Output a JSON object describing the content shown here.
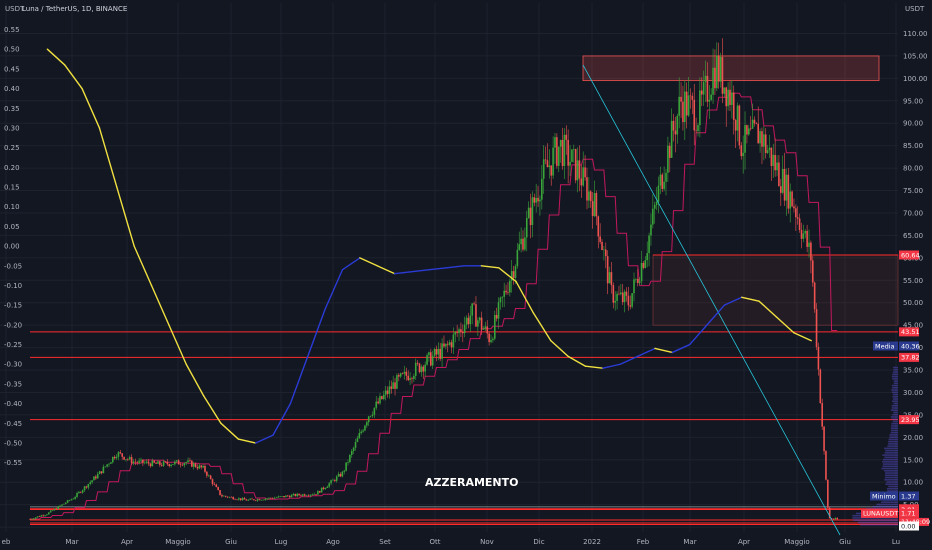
{
  "chart_data": {
    "type": "candlestick",
    "title": "Luna / TetherUS, 1D, BINANCE",
    "left_axis": {
      "unit": "USDT",
      "range": [
        -0.575,
        0.575
      ],
      "ticks": [
        "0.55",
        "0.50",
        "0.45",
        "0.40",
        "0.35",
        "0.30",
        "0.25",
        "0.20",
        "0.15",
        "0.10",
        "0.05",
        "0.00",
        "-0.05",
        "-0.10",
        "-0.15",
        "-0.20",
        "-0.25",
        "-0.30",
        "-0.35",
        "-0.40",
        "-0.45",
        "-0.50",
        "-0.55"
      ]
    },
    "right_axis": {
      "unit": "USDT",
      "ticks": [
        "110.00",
        "105.00",
        "100.00",
        "95.00",
        "90.00",
        "85.00",
        "80.00",
        "75.00",
        "70.00",
        "65.00",
        "60.00",
        "55.00",
        "50.00",
        "45.00",
        "40.00",
        "35.00",
        "30.00",
        "25.00",
        "20.00",
        "15.00",
        "10.00",
        "5.00",
        "0.00"
      ]
    },
    "x_axis": {
      "ticks": [
        "eb",
        "Mar",
        "Apr",
        "Maggio",
        "Giu",
        "Lug",
        "Ago",
        "Set",
        "Ott",
        "Nov",
        "Dic",
        "2022",
        "Feb",
        "Mar",
        "Apr",
        "Maggio",
        "Giu",
        "Lu"
      ]
    },
    "price_path": [
      [
        0,
        1.8
      ],
      [
        0.02,
        3.0
      ],
      [
        0.05,
        6.5
      ],
      [
        0.08,
        12.0
      ],
      [
        0.1,
        16.5
      ],
      [
        0.12,
        14.5
      ],
      [
        0.15,
        14.0
      ],
      [
        0.18,
        14.5
      ],
      [
        0.2,
        13.0
      ],
      [
        0.22,
        7.0
      ],
      [
        0.25,
        6.0
      ],
      [
        0.28,
        6.5
      ],
      [
        0.3,
        7.0
      ],
      [
        0.33,
        7.5
      ],
      [
        0.36,
        12.0
      ],
      [
        0.39,
        25.0
      ],
      [
        0.42,
        32.0
      ],
      [
        0.45,
        36.0
      ],
      [
        0.48,
        40.0
      ],
      [
        0.51,
        48.0
      ],
      [
        0.53,
        42.0
      ],
      [
        0.56,
        60.0
      ],
      [
        0.59,
        78.0
      ],
      [
        0.61,
        85.0
      ],
      [
        0.63,
        80.0
      ],
      [
        0.65,
        72.0
      ],
      [
        0.67,
        52.0
      ],
      [
        0.69,
        50.0
      ],
      [
        0.71,
        62.0
      ],
      [
        0.73,
        80.0
      ],
      [
        0.75,
        95.0
      ],
      [
        0.77,
        92.0
      ],
      [
        0.79,
        103.0
      ],
      [
        0.81,
        95.0
      ],
      [
        0.82,
        85.0
      ],
      [
        0.84,
        88.0
      ],
      [
        0.86,
        80.0
      ],
      [
        0.88,
        72.0
      ],
      [
        0.9,
        60.0
      ],
      [
        0.91,
        30.0
      ],
      [
        0.92,
        2.0
      ],
      [
        0.93,
        1.71
      ]
    ],
    "horizontal_levels": [
      {
        "value": 60.64,
        "label": "60.64"
      },
      {
        "value": 43.51,
        "label": "43.51"
      },
      {
        "value": 37.82,
        "label": "37.82"
      },
      {
        "value": 23.95,
        "label": "23.95"
      },
      {
        "value": 4.08,
        "label": "4.08"
      },
      {
        "value": 3.91,
        "label": "3.91"
      },
      {
        "value": 1.58,
        "label": "1.58"
      },
      {
        "value": 0.9,
        "label": "0.90"
      },
      {
        "value": 0.57,
        "label": "0.57"
      }
    ],
    "price_tags": [
      {
        "label": "LUNAUSDT",
        "value": "1.71",
        "countdown": "11:48:09"
      },
      {
        "label": "Media",
        "value": "40.36"
      },
      {
        "label": "Minimo",
        "value": "1.37"
      },
      {
        "label": "",
        "value": "0.00"
      }
    ],
    "oscillator": [
      [
        0.02,
        0.5
      ],
      [
        0.04,
        0.46
      ],
      [
        0.06,
        0.4
      ],
      [
        0.08,
        0.3
      ],
      [
        0.1,
        0.15
      ],
      [
        0.12,
        0.0
      ],
      [
        0.14,
        -0.1
      ],
      [
        0.16,
        -0.2
      ],
      [
        0.18,
        -0.3
      ],
      [
        0.2,
        -0.38
      ],
      [
        0.22,
        -0.45
      ],
      [
        0.24,
        -0.49
      ],
      [
        0.26,
        -0.5
      ],
      [
        0.28,
        -0.48
      ],
      [
        0.3,
        -0.4
      ],
      [
        0.32,
        -0.28
      ],
      [
        0.34,
        -0.16
      ],
      [
        0.36,
        -0.06
      ],
      [
        0.38,
        -0.03
      ],
      [
        0.4,
        -0.05
      ],
      [
        0.42,
        -0.07
      ],
      [
        0.44,
        -0.065
      ],
      [
        0.46,
        -0.06
      ],
      [
        0.48,
        -0.055
      ],
      [
        0.5,
        -0.05
      ],
      [
        0.52,
        -0.05
      ],
      [
        0.54,
        -0.055
      ],
      [
        0.56,
        -0.09
      ],
      [
        0.58,
        -0.17
      ],
      [
        0.6,
        -0.24
      ],
      [
        0.62,
        -0.28
      ],
      [
        0.64,
        -0.305
      ],
      [
        0.66,
        -0.31
      ],
      [
        0.68,
        -0.3
      ],
      [
        0.7,
        -0.28
      ],
      [
        0.72,
        -0.26
      ],
      [
        0.74,
        -0.27
      ],
      [
        0.76,
        -0.25
      ],
      [
        0.78,
        -0.2
      ],
      [
        0.8,
        -0.15
      ],
      [
        0.82,
        -0.13
      ],
      [
        0.84,
        -0.14
      ],
      [
        0.86,
        -0.18
      ],
      [
        0.88,
        -0.22
      ],
      [
        0.9,
        -0.24
      ]
    ],
    "annotations": [
      {
        "text": "AZZERAMENTO"
      }
    ],
    "colors": {
      "background": "#131722",
      "grid": "#1e222d",
      "axis_text": "#b2b5be",
      "candle_up": "#26a69a",
      "candle_green": "#3aa63a",
      "candle_down": "#ef5350",
      "level_line": "#ff2b2b",
      "oscillator_falling": "#f0e040",
      "oscillator_rising": "#2a3bd6",
      "moving_average": "#c2185b",
      "trendline": "#26c6da",
      "tag_red": "#f23645",
      "tag_blue": "#2a3b8f",
      "volume_profile": "#5b4fd6"
    }
  }
}
